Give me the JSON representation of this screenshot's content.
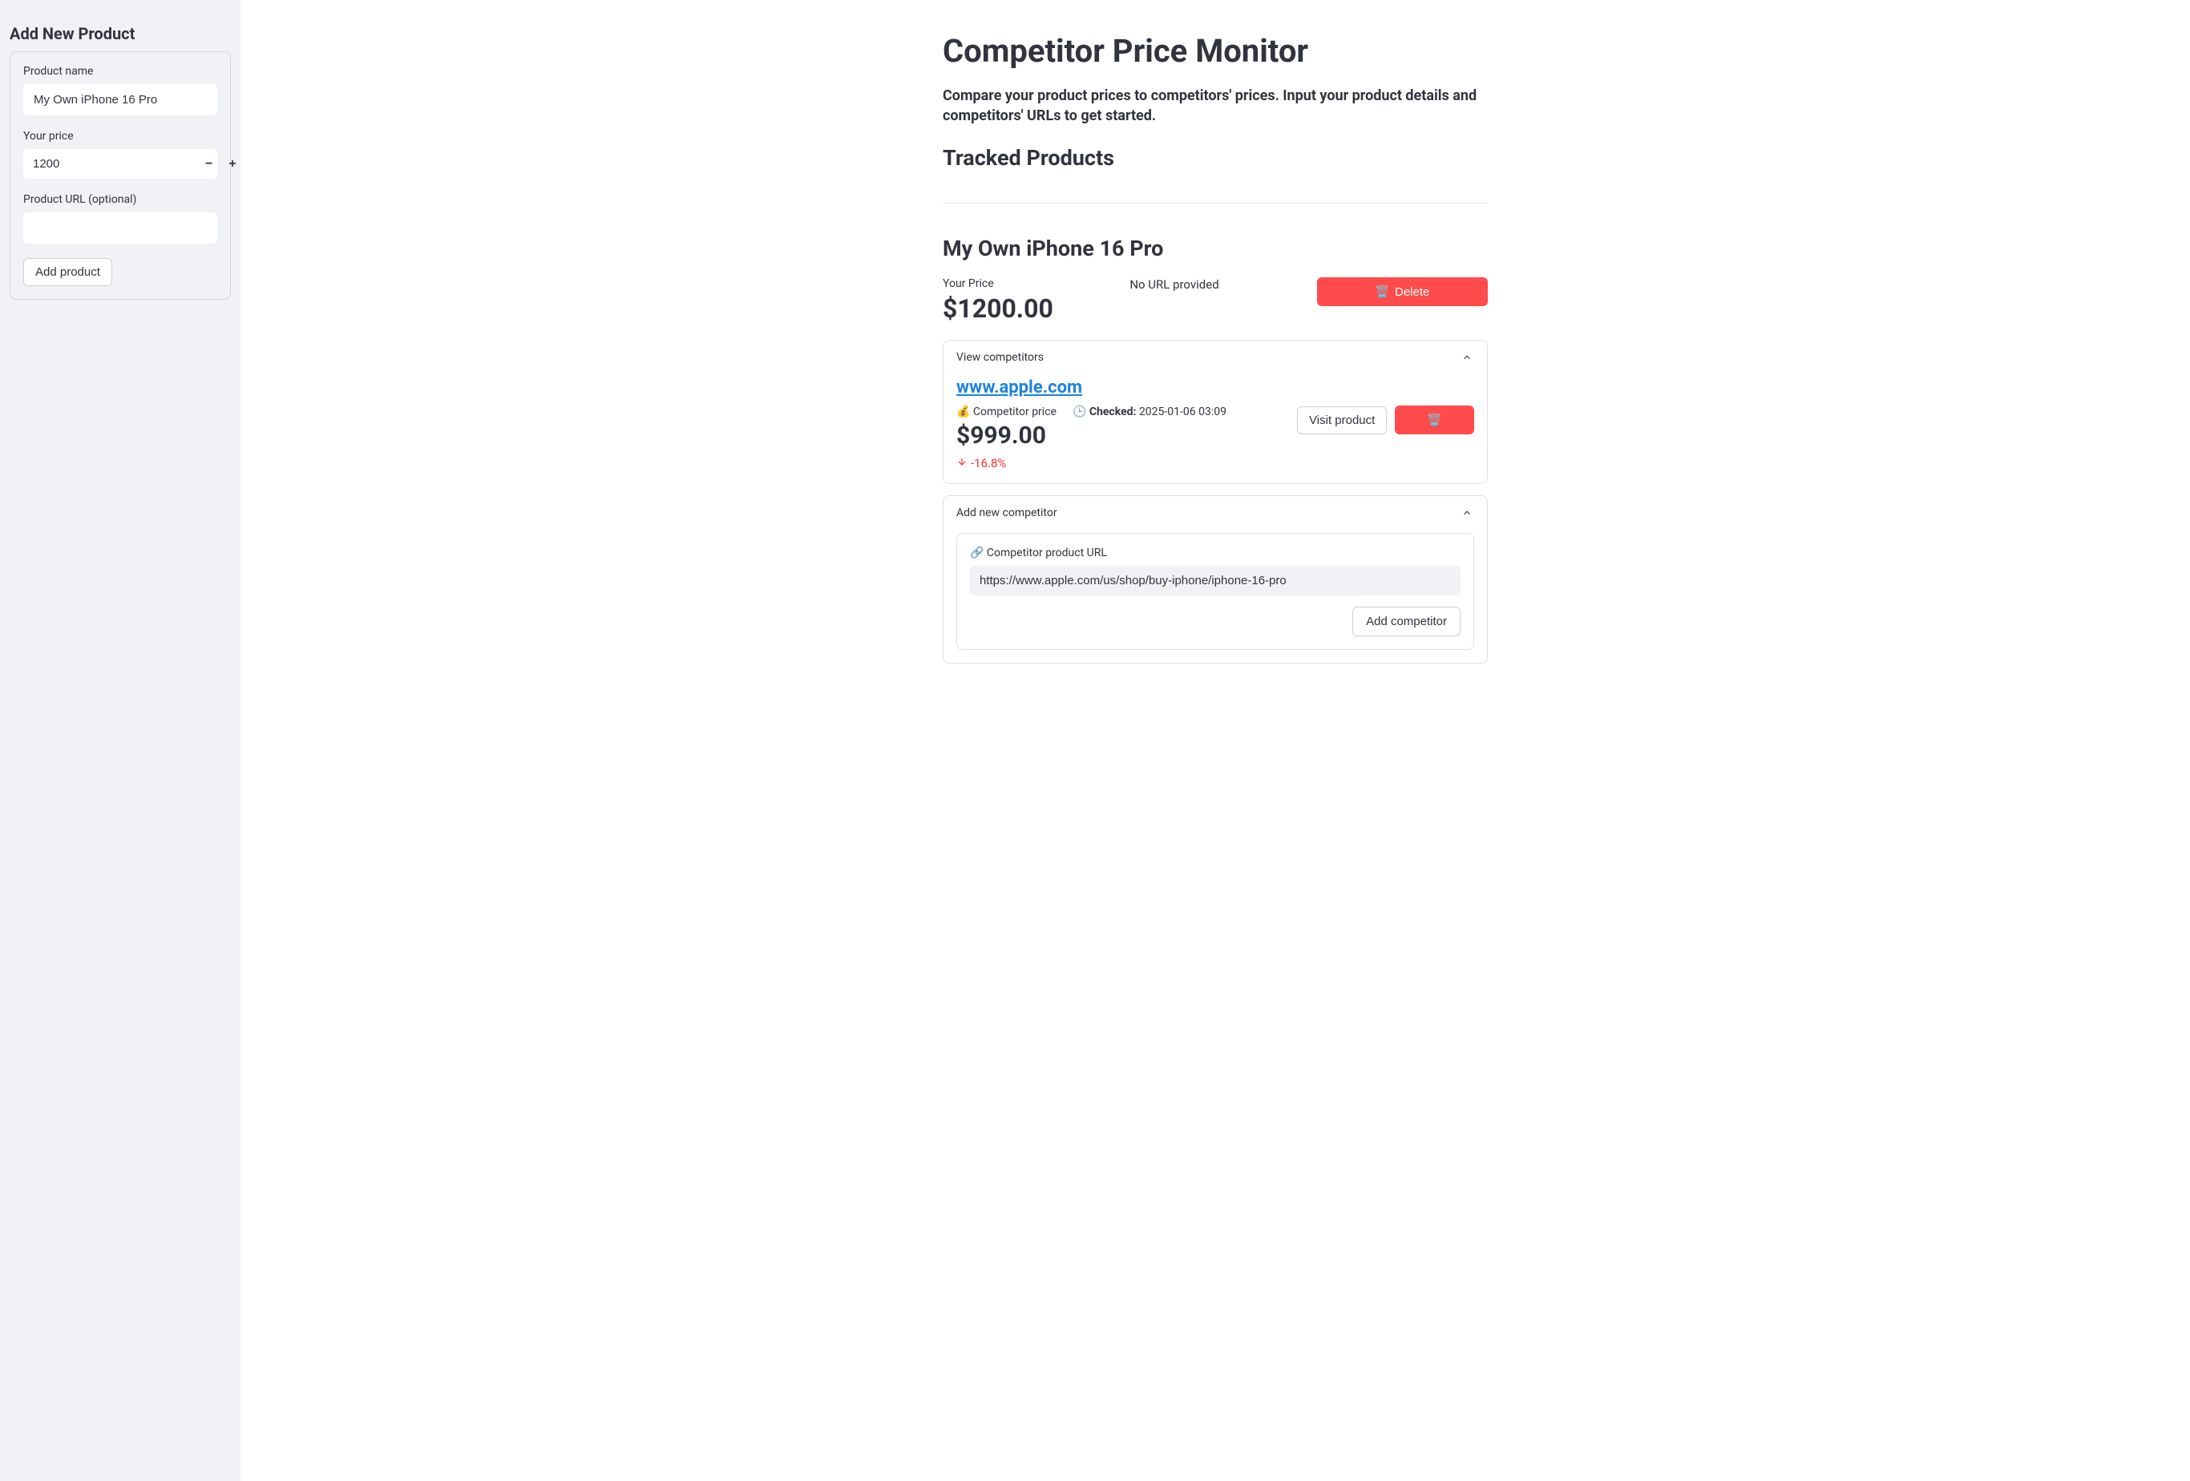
{
  "sidebar": {
    "title": "Add New Product",
    "product_name_label": "Product name",
    "product_name_value": "My Own iPhone 16 Pro",
    "price_label": "Your price",
    "price_value": "1200",
    "url_label": "Product URL (optional)",
    "url_value": "",
    "add_button": "Add product"
  },
  "main": {
    "title": "Competitor Price Monitor",
    "subtitle": "Compare your product prices to competitors' prices. Input your product details and competitors' URLs to get started.",
    "tracked_title": "Tracked Products",
    "product": {
      "name": "My Own iPhone 16 Pro",
      "your_price_label": "Your Price",
      "your_price_value": "$1200.00",
      "no_url": "No URL provided",
      "delete_label": "Delete"
    },
    "view_competitors": {
      "title": "View competitors",
      "competitor": {
        "host": "www.apple.com",
        "price_label": "💰 Competitor price",
        "price_value": "$999.00",
        "checked_prefix": "🕒 ",
        "checked_bold": "Checked:",
        "checked_value": " 2025-01-06 03:09",
        "visit_label": "Visit product",
        "delta": "-16.8%"
      }
    },
    "add_competitor": {
      "title": "Add new competitor",
      "url_label": "🔗 Competitor product URL",
      "url_value": "https://www.apple.com/us/shop/buy-iphone/iphone-16-pro",
      "button": "Add competitor"
    }
  },
  "icons": {
    "trash": "🗑️"
  }
}
